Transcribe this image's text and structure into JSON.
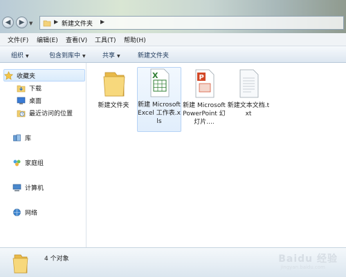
{
  "address_bar": {
    "path": "新建文件夹"
  },
  "menu": [
    "文件(F)",
    "编辑(E)",
    "查看(V)",
    "工具(T)",
    "帮助(H)"
  ],
  "toolbar": {
    "organize": "组织",
    "include_in_library": "包含到库中",
    "share": "共享",
    "new_folder": "新建文件夹"
  },
  "sidebar": {
    "favorites": "收藏夹",
    "downloads": "下载",
    "desktop": "桌面",
    "recent": "最近访问的位置",
    "libraries": "库",
    "homegroup": "家庭组",
    "computer": "计算机",
    "network": "网络"
  },
  "files": [
    {
      "name": "新建文件夹",
      "icon": "folder-icon"
    },
    {
      "name": "新建 Microsoft Excel 工作表.xls",
      "icon": "excel-file-icon"
    },
    {
      "name": "新建 Microsoft PowerPoint 幻灯片....",
      "icon": "powerpoint-file-icon"
    },
    {
      "name": "新建文本文档.txt",
      "icon": "text-file-icon"
    }
  ],
  "status": {
    "count": "4 个对象"
  },
  "watermark": {
    "text": "Baidu 经验",
    "sub": "jingyan.baidu.com"
  }
}
